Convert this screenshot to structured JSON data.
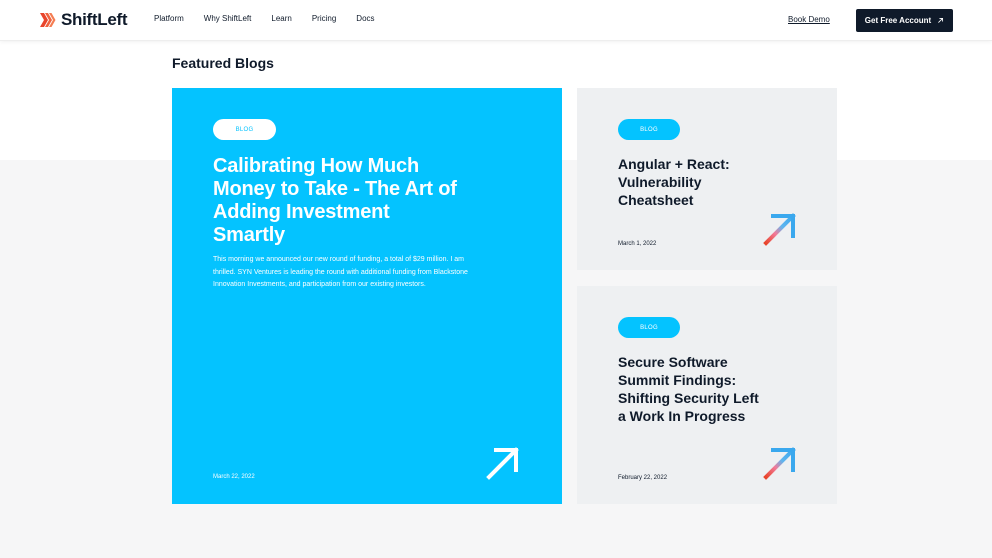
{
  "header": {
    "logo_text": "ShiftLeft",
    "nav": [
      {
        "label": "Platform"
      },
      {
        "label": "Why ShiftLeft"
      },
      {
        "label": "Learn"
      },
      {
        "label": "Pricing"
      },
      {
        "label": "Docs"
      }
    ],
    "book_demo": "Book Demo",
    "cta": "Get Free Account"
  },
  "section": {
    "title": "Featured Blogs"
  },
  "cards": [
    {
      "tag": "BLOG",
      "title": "Calibrating How Much Money to Take - The Art of Adding Investment Smartly",
      "description": "This morning we announced our new round of funding, a total of $29 million. I am thrilled. SYN Ventures is leading the round with additional funding from Blackstone Innovation Investments, and participation from our existing investors.",
      "date": "March 22, 2022"
    },
    {
      "tag": "BLOG",
      "title": "Angular + React: Vulnerability Cheatsheet",
      "date": "March 1, 2022"
    },
    {
      "tag": "BLOG",
      "title": "Secure Software Summit Findings: Shifting Security Left a Work In Progress",
      "date": "February 22, 2022"
    }
  ],
  "colors": {
    "accent_blue": "#04c3ff",
    "navy": "#0f1a2a",
    "logo_red": "#e8452c",
    "card_grey": "#eef0f2"
  },
  "icons": {
    "logo": "shiftleft-chevrons-logo",
    "cta_arrow": "arrow-up-right-icon",
    "card_arrow": "arrow-up-right-icon"
  }
}
